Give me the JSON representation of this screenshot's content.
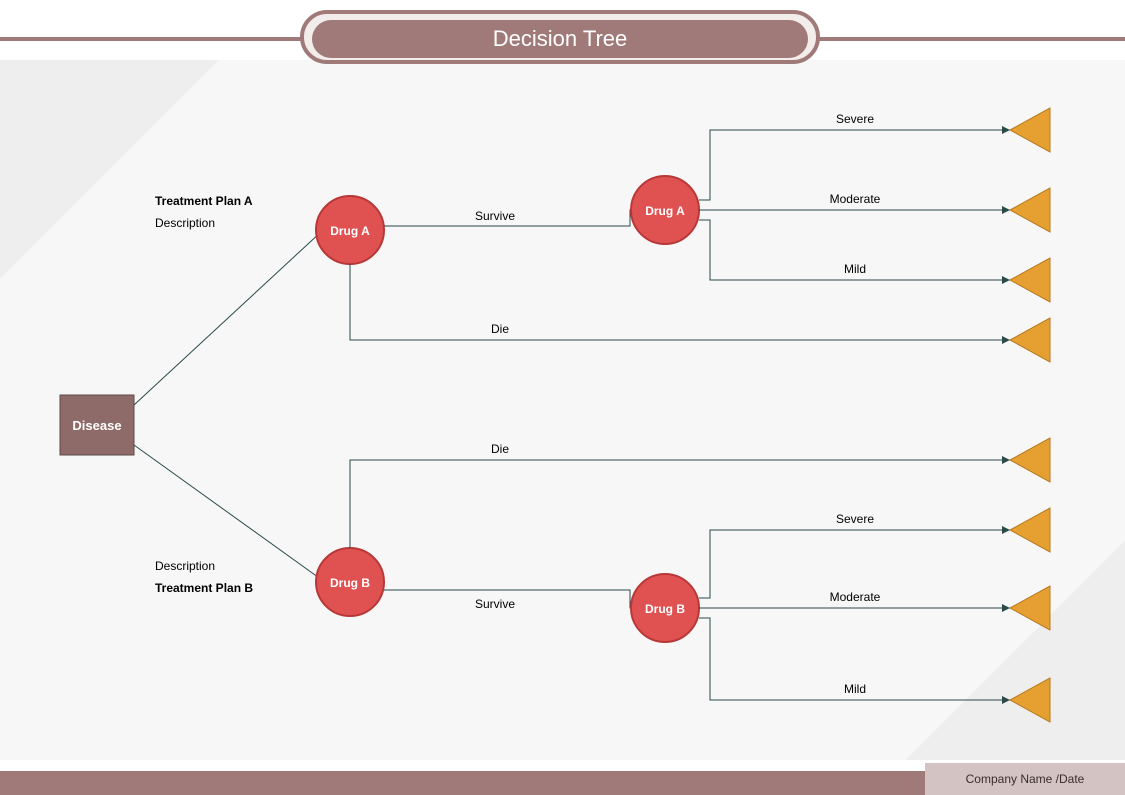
{
  "title": "Decision Tree",
  "footer": "Company Name /Date",
  "root": {
    "label": "Disease"
  },
  "branches": {
    "a": {
      "plan_label": "Treatment Plan A",
      "plan_desc": "Description",
      "drug1": "Drug A",
      "survive": "Survive",
      "die": "Die",
      "drug2": "Drug A",
      "outcomes": {
        "severe": "Severe",
        "moderate": "Moderate",
        "mild": "Mild"
      }
    },
    "b": {
      "plan_label": "Treatment Plan B",
      "plan_desc": "Description",
      "drug1": "Drug  B",
      "survive": "Survive",
      "die": "Die",
      "drug2": "Drug  B",
      "outcomes": {
        "severe": "Severe",
        "moderate": "Moderate",
        "mild": "Mild"
      }
    }
  },
  "colors": {
    "brown": "#a07a78",
    "brown_fill": "#8e6a68",
    "red": "#e05252",
    "red_stroke": "#b83838",
    "orange": "#e6a031",
    "orange_stroke": "#b87a20",
    "line": "#2a4a4a"
  }
}
